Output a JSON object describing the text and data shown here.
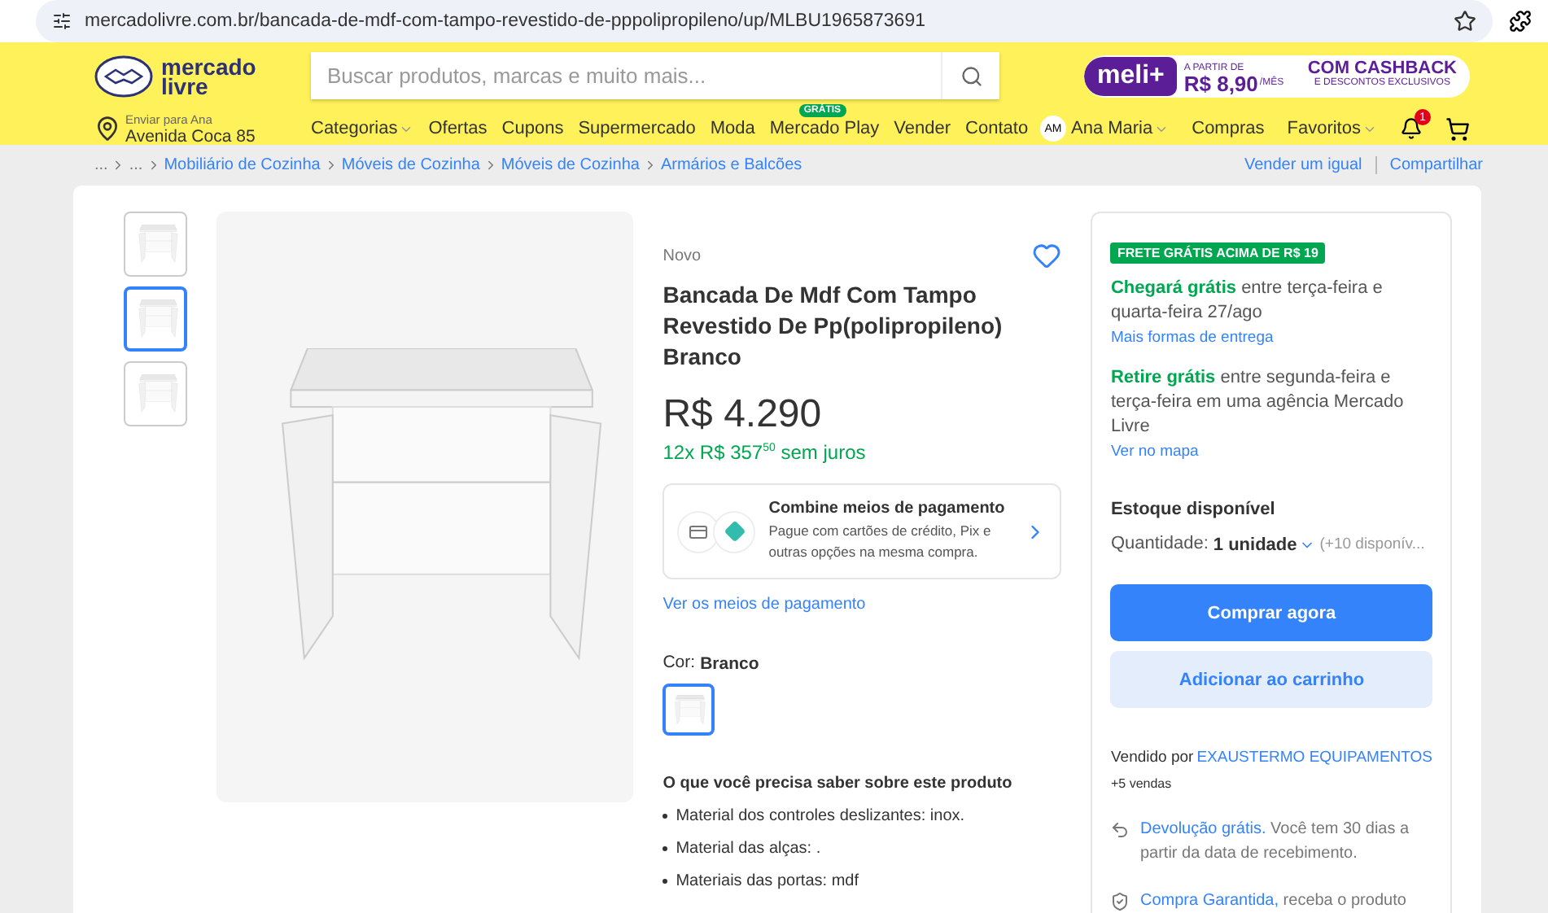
{
  "browser": {
    "url": "mercadolivre.com.br/bancada-de-mdf-com-tampo-revestido-de-pppolipropileno/up/MLBU1965873691",
    "bookmarked": false
  },
  "header": {
    "logo": [
      "mercado",
      "livre"
    ],
    "search": {
      "placeholder": "Buscar produtos, marcas e muito mais..."
    },
    "promo": {
      "brand": "meli+",
      "from": "A PARTIR DE",
      "price": "R$ 8,90",
      "period": "/MÊS",
      "headline": "COM CASHBACK",
      "sub": "E DESCONTOS EXCLUSIVOS"
    },
    "location": {
      "label": "Enviar para Ana",
      "address": "Avenida Coca 85"
    },
    "nav": [
      {
        "label": "Categorias",
        "dropdown": true
      },
      {
        "label": "Ofertas",
        "dropdown": false
      },
      {
        "label": "Cupons",
        "dropdown": false
      },
      {
        "label": "Supermercado",
        "dropdown": false
      },
      {
        "label": "Moda",
        "dropdown": false
      },
      {
        "label": "Mercado Play",
        "dropdown": false,
        "badge": "GRÁTIS"
      },
      {
        "label": "Vender",
        "dropdown": false
      },
      {
        "label": "Contato",
        "dropdown": false
      }
    ],
    "user": {
      "initials": "AM",
      "name": "Ana Maria"
    },
    "user_nav": [
      {
        "label": "Compras",
        "dropdown": false
      },
      {
        "label": "Favoritos",
        "dropdown": true
      }
    ],
    "notifications": "1"
  },
  "breadcrumb": {
    "items": [
      "...",
      "...",
      "Mobiliário de Cozinha",
      "Móveis de Cozinha",
      "Móveis de Cozinha",
      "Armários e Balcões"
    ],
    "actions": [
      "Vender um igual",
      "Compartilhar"
    ]
  },
  "gallery": {
    "thumbnails": [
      {
        "selected": false
      },
      {
        "selected": true
      },
      {
        "selected": false
      }
    ]
  },
  "product": {
    "condition": "Novo",
    "favorited": false,
    "title": "Bancada De Mdf Com Tampo Revestido De Pp(polipropileno) Branco",
    "price": "R$ 4.290",
    "installments": "12x R$ 357$^{50}$ sem juros",
    "payment": {
      "title": "Combine meios de pagamento",
      "text": "Pague com cartões de crédito, Pix e outras opções na mesma compra."
    },
    "payment_link": "Ver os meios de pagamento",
    "color": {
      "label": "Cor:",
      "value": "Branco",
      "swatches": [
        {
          "selected": true
        }
      ]
    },
    "features_title": "O que você precisa saber sobre este produto",
    "features": [
      "Material dos controles deslizantes: inox.",
      "Material das alças: .",
      "Materiais das portas: mdf"
    ]
  },
  "buy_box": {
    "badge": "FRETE GRÁTIS ACIMA DE R$ 19",
    "delivery": [
      {
        "highlight": "Chegará grátis",
        "text": "entre terça-feira e quarta-feira 27/ago",
        "link": "Mais formas de entrega"
      },
      {
        "highlight": "Retire grátis",
        "text": "entre segunda-feira e terça-feira em uma agência Mercado Livre",
        "link": "Ver no mapa"
      }
    ],
    "stock": "Estoque disponível",
    "quantity_label": "Quantidade:",
    "quantity": "1 unidade",
    "available": "(+10 disponív...",
    "buttons": [
      {
        "label": "Comprar agora",
        "kind": "primary"
      },
      {
        "label": "Adicionar ao carrinho",
        "kind": "secondary"
      }
    ],
    "seller_label": "Vendido por",
    "seller": "EXAUSTERMO EQUIPAMENTOS",
    "sales": "+5 vendas",
    "benefits": [
      {
        "kind": "return",
        "link": "Devolução grátis.",
        "text": "Você tem 30 dias a partir da data de recebimento."
      },
      {
        "kind": "shield",
        "link": "Compra Garantida,",
        "text": "receba o produto"
      }
    ]
  }
}
